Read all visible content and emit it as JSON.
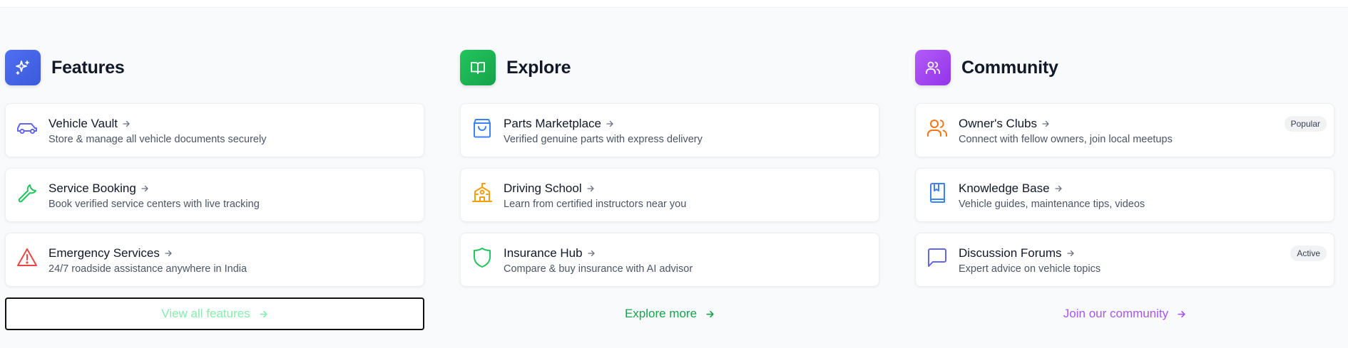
{
  "colors": {
    "features_accent": "#4f6ef2",
    "explore_accent": "#16a34a",
    "community_accent": "#a855f7",
    "features_link": "#86efac",
    "explore_link": "#16a34a",
    "community_link": "#a855f7"
  },
  "features": {
    "title": "Features",
    "icon": "sparkles-icon",
    "items": [
      {
        "title": "Vehicle Vault",
        "desc": "Store & manage all vehicle documents securely",
        "icon": "car-icon"
      },
      {
        "title": "Service Booking",
        "desc": "Book verified service centers with live tracking",
        "icon": "wrench-icon"
      },
      {
        "title": "Emergency Services",
        "desc": "24/7 roadside assistance anywhere in India",
        "icon": "alert-triangle-icon"
      }
    ],
    "link": "View all features"
  },
  "explore": {
    "title": "Explore",
    "icon": "book-open-icon",
    "items": [
      {
        "title": "Parts Marketplace",
        "desc": "Verified genuine parts with express delivery",
        "icon": "shopping-bag-icon"
      },
      {
        "title": "Driving School",
        "desc": "Learn from certified instructors near you",
        "icon": "school-icon"
      },
      {
        "title": "Insurance Hub",
        "desc": "Compare & buy insurance with AI advisor",
        "icon": "shield-icon"
      }
    ],
    "link": "Explore more"
  },
  "community": {
    "title": "Community",
    "icon": "users-icon",
    "items": [
      {
        "title": "Owner's Clubs",
        "desc": "Connect with fellow owners, join local meetups",
        "icon": "users-icon",
        "badge": "Popular"
      },
      {
        "title": "Knowledge Base",
        "desc": "Vehicle guides, maintenance tips, videos",
        "icon": "bookmark-book-icon"
      },
      {
        "title": "Discussion Forums",
        "desc": "Expert advice on vehicle topics",
        "icon": "message-square-icon",
        "badge": "Active"
      }
    ],
    "link": "Join our community"
  }
}
